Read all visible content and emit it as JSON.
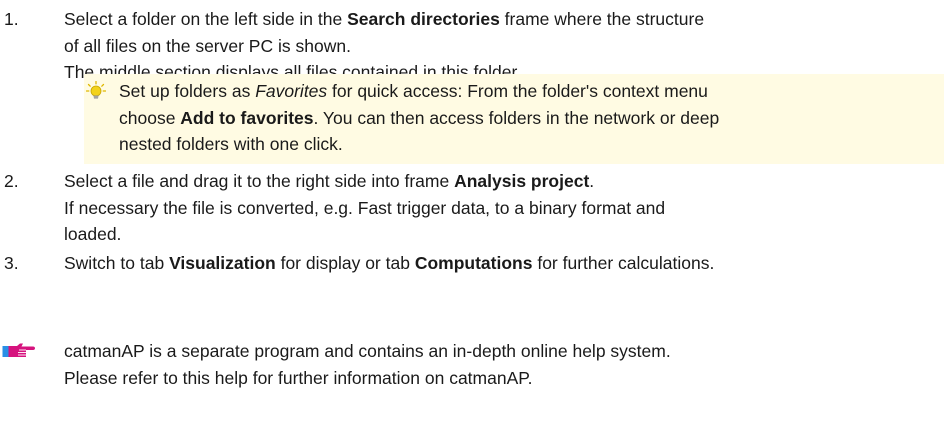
{
  "steps": [
    {
      "number": "1.",
      "lines": [
        [
          "Select a folder on the left side in the ",
          "Search directories",
          " frame where the structure"
        ],
        [
          "of all files on the server PC is shown."
        ],
        [
          "The middle section displays all files contained in this folder."
        ]
      ]
    },
    {
      "number": "2.",
      "lines": [
        [
          "Select a file and drag it to the right side into frame ",
          "Analysis project",
          "."
        ],
        [
          "If necessary the file is converted, e.g. Fast trigger data, to a binary format and"
        ],
        [
          "loaded."
        ]
      ]
    },
    {
      "number": "3.",
      "lines": [
        [
          "Switch to tab ",
          "Visualization",
          " for display or tab ",
          "Computations",
          " for further calculations."
        ]
      ]
    }
  ],
  "tip": {
    "icon": "lightbulb-icon",
    "line1": [
      "Set up folders as ",
      "Favorites",
      " for quick access: From the folder's context menu"
    ],
    "line2": [
      "choose ",
      "Add to favorites",
      ". You can then access folders in the network or deep"
    ],
    "line3": "nested folders with one click."
  },
  "note": {
    "icon": "pointing-hand-icon",
    "line1": "catmanAP is a separate program and contains an in-depth online help system.",
    "line2": "Please refer to this help for further information on catmanAP."
  },
  "colors": {
    "tip_background": "#fffbe3",
    "bulb_yellow": "#f3d21b",
    "hand_magenta": "#d6137e",
    "hand_blue": "#2a8fe6"
  }
}
